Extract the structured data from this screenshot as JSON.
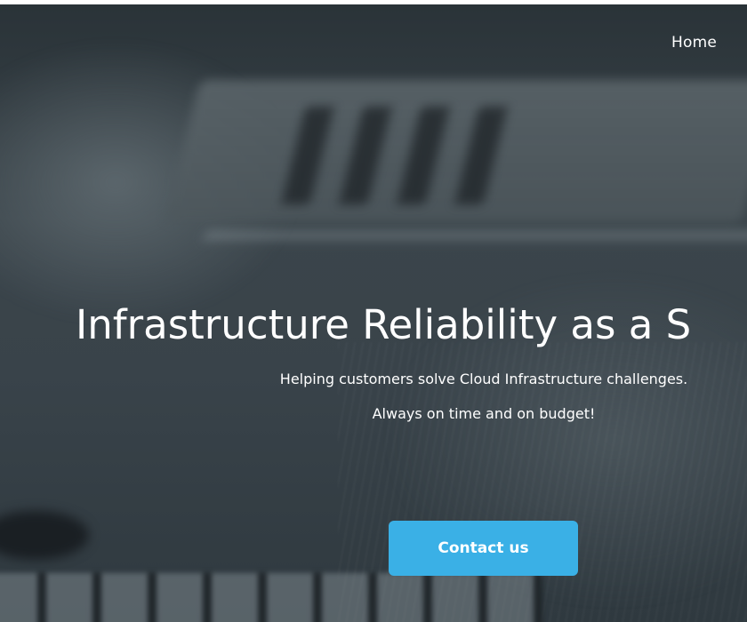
{
  "nav": {
    "home_label": "Home"
  },
  "hero": {
    "title": "Infrastructure Reliability as a S",
    "subtitle_line1": "Helping customers solve Cloud Infrastructure challenges.",
    "subtitle_line2": "Always on time and on budget!",
    "cta_label": "Contact us"
  },
  "colors": {
    "accent": "#3ab0e6",
    "hero_text": "#ffffff",
    "hero_overlay": "#39434a"
  }
}
